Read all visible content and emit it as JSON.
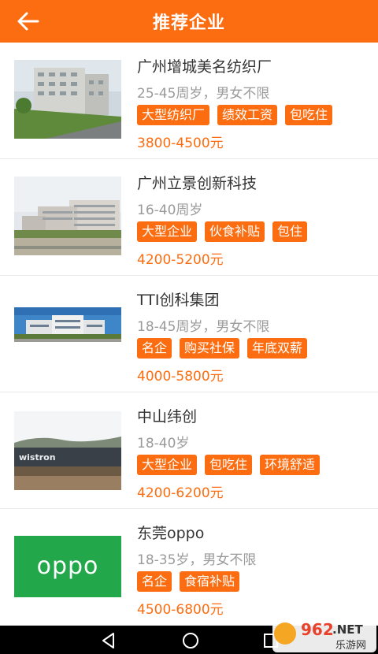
{
  "header": {
    "title": "推荐企业"
  },
  "companies": [
    {
      "name": "广州增城美名纺织厂",
      "age": "25-45周岁，男女不限",
      "tags": [
        "大型纺织厂",
        "绩效工资",
        "包吃住"
      ],
      "salary": "3800-4500元"
    },
    {
      "name": "广州立景创新科技",
      "age": "16-40周岁",
      "tags": [
        "大型企业",
        "伙食补贴",
        "包住"
      ],
      "salary": "4200-5200元"
    },
    {
      "name": "TTI创科集团",
      "age": "18-45周岁，男女不限",
      "tags": [
        "名企",
        "购买社保",
        "年底双薪"
      ],
      "salary": "4000-5800元"
    },
    {
      "name": "中山纬创",
      "age": "18-40岁",
      "tags": [
        "大型企业",
        "包吃住",
        "环境舒适"
      ],
      "salary": "4200-6200元"
    },
    {
      "name": "东莞oppo",
      "age": "18-35岁，男女不限",
      "tags": [
        "名企",
        "食宿补贴"
      ],
      "salary": "4500-6800元"
    }
  ],
  "thumb_labels": {
    "wistron": "wistron",
    "oppo": "oppo"
  },
  "watermark": {
    "number": "962",
    "suffix": ".NET",
    "text": "乐游网"
  },
  "colors": {
    "accent": "#fb6d10",
    "text": "#333333",
    "muted": "#9a9a9a"
  }
}
